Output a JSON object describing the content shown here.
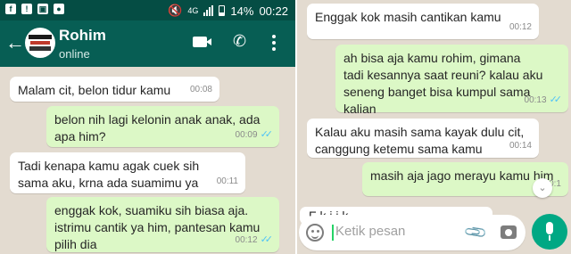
{
  "status_bar": {
    "battery": "14%",
    "time": "00:22",
    "network": "4G"
  },
  "header": {
    "contact_name": "Rohim",
    "status": "online",
    "back_icon": "arrow-left-icon",
    "video_icon": "video-camera-icon",
    "call_icon": "phone-icon",
    "menu_icon": "more-vertical-icon"
  },
  "left_messages": [
    {
      "direction": "in",
      "text": "Malam cit, belon tidur kamu",
      "time": "00:08"
    },
    {
      "direction": "out",
      "text": "belon nih lagi kelonin anak anak, ada\napa him?",
      "time": "00:09"
    },
    {
      "direction": "in",
      "text": "Tadi kenapa kamu agak cuek sih\nsama aku, krna ada suamimu ya",
      "time": "00:11"
    },
    {
      "direction": "out",
      "text": "enggak kok, suamiku sih biasa aja.\nistrimu cantik ya him, pantesan kamu\npilih dia",
      "time": "00:12"
    }
  ],
  "right_messages": [
    {
      "direction": "in",
      "text": "Enggak kok masih cantikan kamu",
      "time": "00:12"
    },
    {
      "direction": "out",
      "text": "ah bisa aja kamu rohim, gimana\ntadi kesannya saat reuni? kalau aku\nseneng banget bisa kumpul sama\nkalian",
      "time": "00:13"
    },
    {
      "direction": "in",
      "text": "Kalau aku masih sama kayak dulu cit,\ncanggung ketemu sama kamu",
      "time": "00:14"
    },
    {
      "direction": "out",
      "text": "masih aja jago merayu kamu him",
      "time": "00:1"
    }
  ],
  "partial_message": {
    "text": "F      k   i  i     k"
  },
  "composer": {
    "placeholder": "Ketik pesan",
    "emoji_icon": "emoji-icon",
    "attach_icon": "paperclip-icon",
    "camera_icon": "camera-icon",
    "mic_icon": "microphone-icon",
    "scroll_icon": "chevron-down-icon"
  },
  "colors": {
    "header": "#075e54",
    "status_bar": "#054d44",
    "outgoing_bubble": "#dcf8c6",
    "incoming_bubble": "#ffffff",
    "chat_background": "#e3dbd0",
    "read_ticks": "#4fc3f7",
    "mic_button": "#00a884"
  }
}
